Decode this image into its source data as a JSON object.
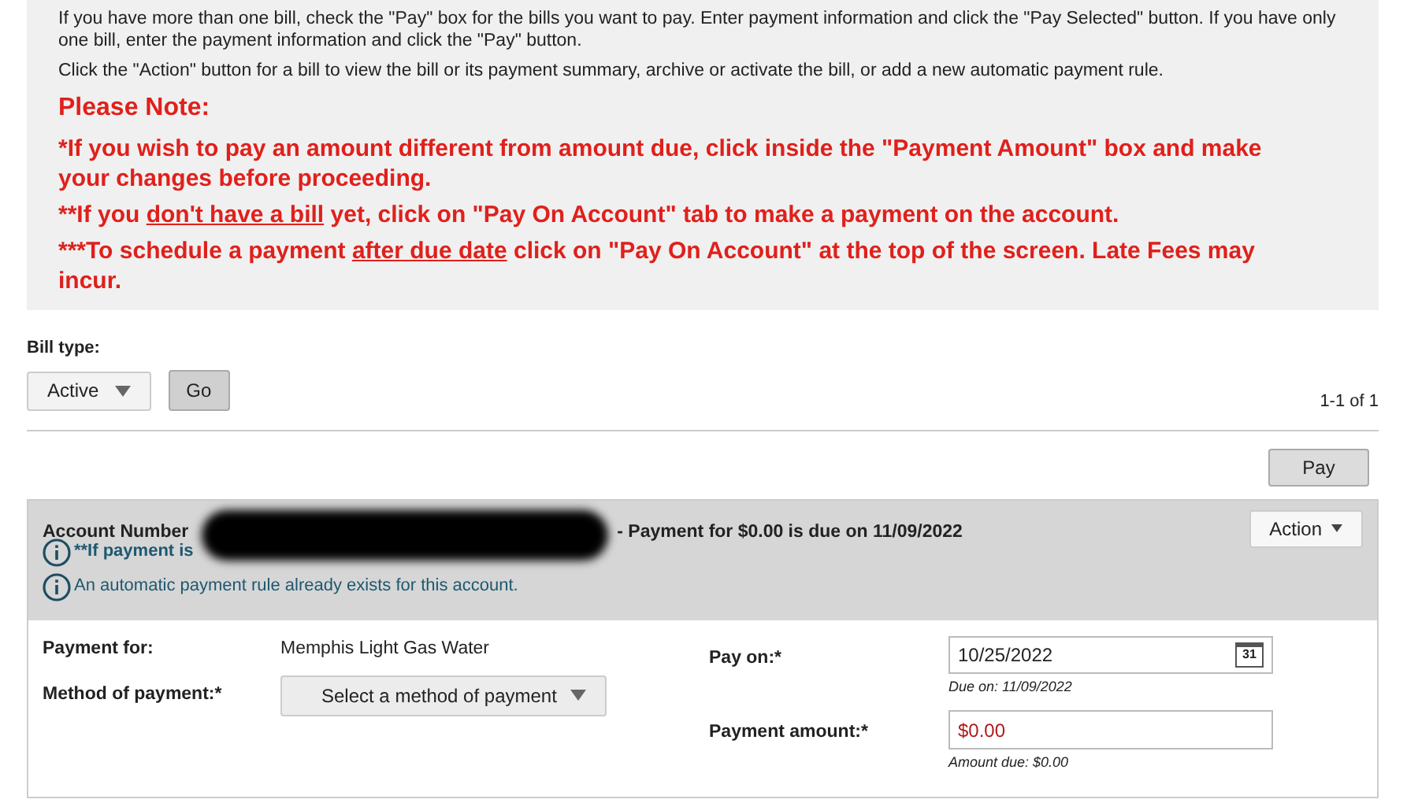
{
  "instructions": {
    "paragraphs": [
      "If you have more than one bill, check the \"Pay\" box for the bills you want to pay. Enter payment information and click the \"Pay Selected\" button. If you have only one bill, enter the payment information and click the \"Pay\" button.",
      "Click the \"Action\" button for a bill to view the bill or its payment summary, archive or activate the bill, or add a new automatic payment rule."
    ],
    "note_title": "Please Note:",
    "notes": [
      [
        {
          "text": "*If you wish to pay an amount different from amount due, click inside the \"Payment Amount\" box and make your changes before proceeding.",
          "underlined": false
        }
      ],
      [
        {
          "text": "**If you ",
          "underlined": false
        },
        {
          "text": "don't have a bill",
          "underlined": true
        },
        {
          "text": " yet, click on \"Pay On Account\" tab to make a payment on the account.",
          "underlined": false
        }
      ],
      [
        {
          "text": "***To schedule a payment ",
          "underlined": false
        },
        {
          "text": "after due date",
          "underlined": true
        },
        {
          "text": " click on \"Pay On Account\" at the top of the screen. Late Fees may incur.",
          "underlined": false
        }
      ]
    ]
  },
  "bill_type": {
    "label": "Bill type:",
    "value": "Active",
    "go": "Go",
    "count": "1-1 of 1"
  },
  "pay_button": "Pay",
  "bill": {
    "account_label": "Account Number",
    "due_text": "- Payment for $0.00 is due on 11/09/2022",
    "action": "Action",
    "late_fee": "**If payment is",
    "auto_rule": "An automatic payment rule already exists for this account.",
    "payment_for_label": "Payment for:",
    "payment_for": "Memphis Light Gas Water",
    "method_label": "Method of payment:*",
    "method_placeholder": "Select a method of payment",
    "pay_on_label": "Pay on:*",
    "pay_on": "10/25/2022",
    "calendar_day": "31",
    "due_on": "Due on: 11/09/2022",
    "amount_label": "Payment amount:*",
    "amount": "$0.00",
    "amount_due": "Amount due: $0.00"
  }
}
